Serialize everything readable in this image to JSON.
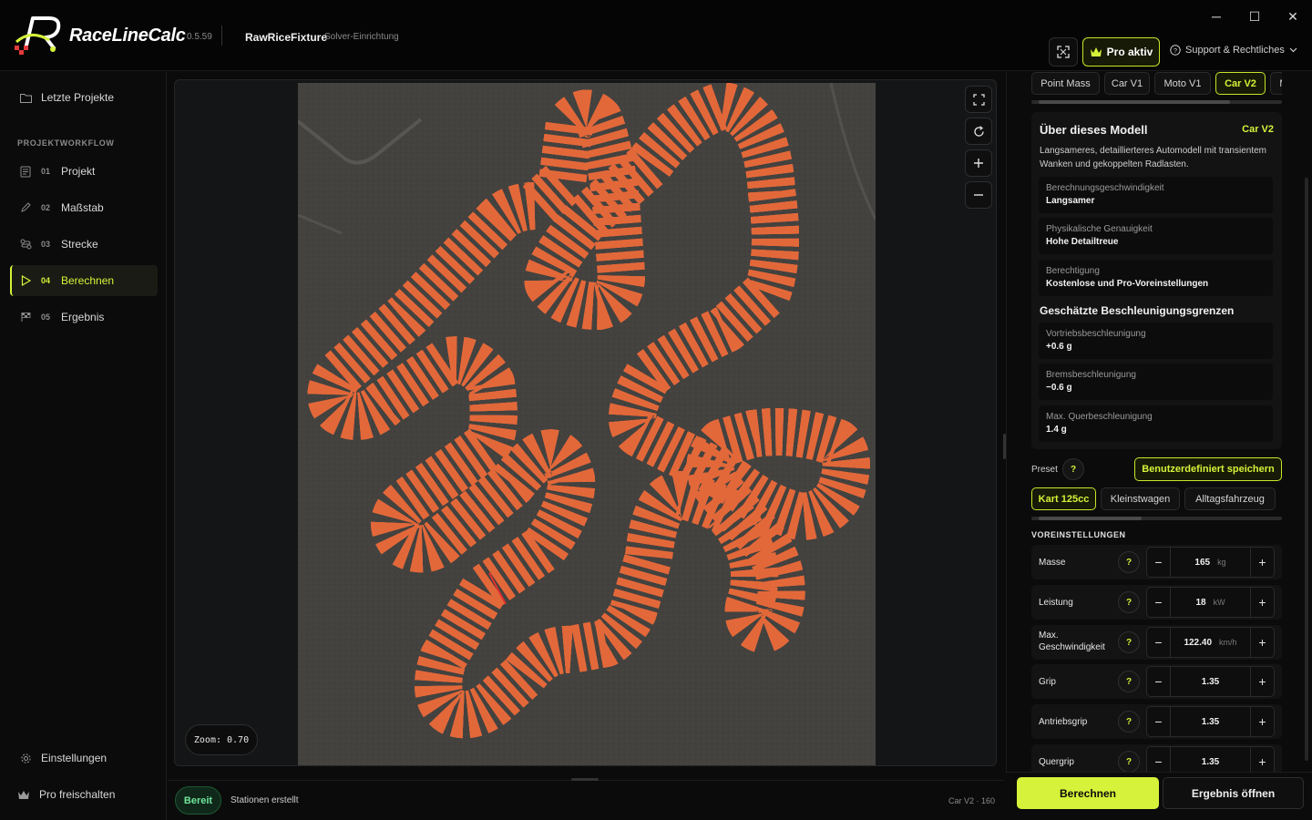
{
  "app": {
    "brand": "RaceLineCalc",
    "version": "0.5.59",
    "project_name": "RawRiceFixture",
    "project_sub": "Solver-Einrichtung"
  },
  "window": {
    "minimize": "─",
    "maximize": "☐",
    "close": "✕"
  },
  "topbar": {
    "pro_label": "Pro aktiv",
    "support_label": "Support & Rechtliches"
  },
  "sidebar": {
    "recent": "Letzte Projekte",
    "section": "PROJEKTWORKFLOW",
    "steps": [
      {
        "num": "01",
        "label": "Projekt"
      },
      {
        "num": "02",
        "label": "Maßstab"
      },
      {
        "num": "03",
        "label": "Strecke"
      },
      {
        "num": "04",
        "label": "Berechnen"
      },
      {
        "num": "05",
        "label": "Ergebnis"
      }
    ],
    "settings": "Einstellungen",
    "unlock_pro": "Pro freischalten"
  },
  "canvas": {
    "zoom_label": "Zoom: 0.70"
  },
  "statusbar": {
    "badge": "Bereit",
    "message": "Stationen erstellt",
    "right": "Car V2 · 160"
  },
  "model_tabs": [
    "Point Mass",
    "Car V1",
    "Moto V1",
    "Car V2",
    "M"
  ],
  "model_card": {
    "title": "Über dieses Modell",
    "tag": "Car V2",
    "description": "Langsameres, detaillierteres Automodell mit transientem Wanken und gekoppelten Radlasten.",
    "info": [
      {
        "label": "Berechnungsgeschwindigkeit",
        "value": "Langsamer"
      },
      {
        "label": "Physikalische Genauigkeit",
        "value": "Hohe Detailtreue"
      },
      {
        "label": "Berechtigung",
        "value": "Kostenlose und Pro-Voreinstellungen"
      }
    ],
    "limits_title": "Geschätzte Beschleunigungsgrenzen",
    "limits": [
      {
        "label": "Vortriebsbeschleunigung",
        "value": "+0.6 g"
      },
      {
        "label": "Bremsbeschleunigung",
        "value": "−0.6 g"
      },
      {
        "label": "Max. Querbeschleunigung",
        "value": "1.4 g"
      }
    ]
  },
  "preset": {
    "label": "Preset",
    "help": "?",
    "save_label": "Benutzerdefiniert speichern",
    "options": [
      "Kart 125cc",
      "Kleinstwagen",
      "Alltagsfahrzeug"
    ],
    "section_title": "VOREINSTELLUNGEN"
  },
  "params": [
    {
      "name": "Masse",
      "value": "165",
      "unit": "kg"
    },
    {
      "name": "Leistung",
      "value": "18",
      "unit": "kW"
    },
    {
      "name": "Max. Geschwindigkeit",
      "value": "122.40",
      "unit": "km/h"
    },
    {
      "name": "Grip",
      "value": "1.35",
      "unit": ""
    },
    {
      "name": "Antriebsgrip",
      "value": "1.35",
      "unit": ""
    },
    {
      "name": "Quergrip",
      "value": "1.35",
      "unit": ""
    }
  ],
  "actions": {
    "calculate": "Berechnen",
    "open_result": "Ergebnis öffnen"
  },
  "colors": {
    "accent": "#d6f23a",
    "background": "#0b0b0c",
    "ready": "#6fe49a",
    "track_edge": "#e2683a"
  }
}
